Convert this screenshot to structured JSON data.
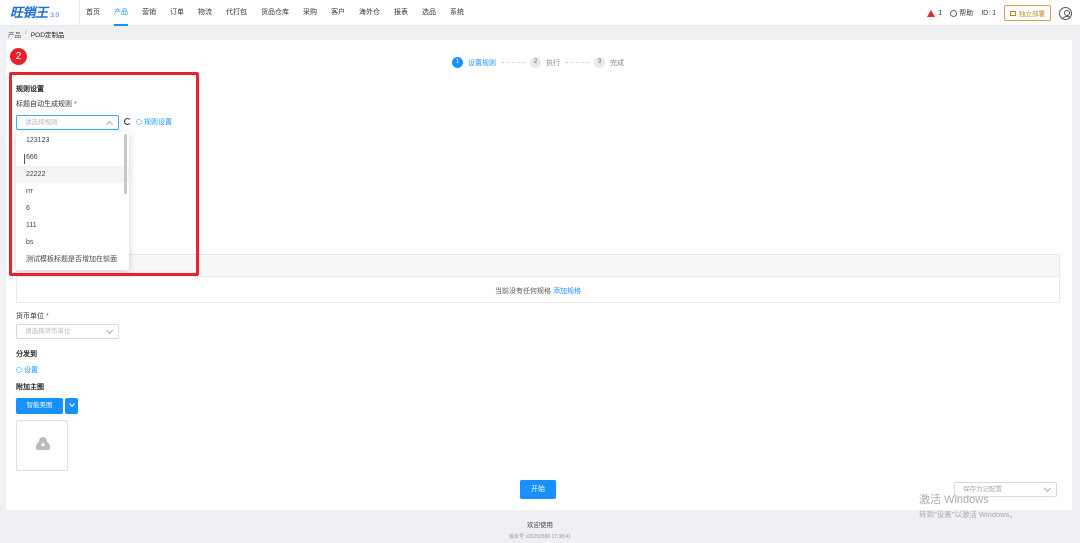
{
  "app": {
    "brand": "旺销王",
    "version": "3.0"
  },
  "nav": {
    "items": [
      "首页",
      "产品",
      "营销",
      "订单",
      "物流",
      "代打包",
      "货品仓库",
      "采购",
      "客户",
      "海外仓",
      "报表",
      "选品",
      "系统"
    ],
    "active_index": 1,
    "alert_count": "1",
    "help_label": "帮助",
    "id_label": "ID: 1",
    "shop_button": "独立部署"
  },
  "breadcrumb": [
    "产品",
    "POD定制品"
  ],
  "steps": [
    {
      "num": "1",
      "label": "设置规则"
    },
    {
      "num": "2",
      "label": "执行"
    },
    {
      "num": "3",
      "label": "完成"
    }
  ],
  "annotation": {
    "badge": "2"
  },
  "rules": {
    "section_title": "规则设置",
    "title_label": "标题自动生成规则",
    "required_mark": "*",
    "placeholder": "请选择规则",
    "settings_link": "规则设置",
    "options": [
      "123123",
      "666",
      "22222",
      "rrr",
      "6",
      "111",
      "bs",
      "测试模板标题是否增加在前面"
    ]
  },
  "spec": {
    "empty_text": "当前没有任何规格",
    "add_link": "添加规格"
  },
  "currency": {
    "label": "货币单位",
    "required_mark": "*",
    "placeholder": "请选择货币单位"
  },
  "distribute": {
    "title": "分发到",
    "settings_link": "设置"
  },
  "main_image": {
    "title": "附加主图",
    "button_label": "智能美图"
  },
  "start_button": "开始",
  "save_select": {
    "placeholder": "保存为记配置"
  },
  "watermark": {
    "line1": "激活 Windows",
    "line2": "转到\"设置\"以激活 Windows。"
  },
  "footer": {
    "welcome": "欢迎使用",
    "version": "版本号 v20250586 17:38:41"
  }
}
